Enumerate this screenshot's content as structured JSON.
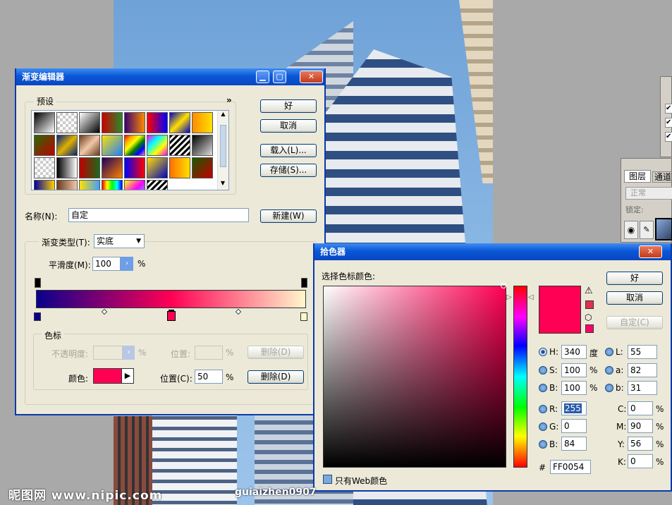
{
  "gradient_editor": {
    "title": "渐变编辑器",
    "presets_label": "预设",
    "presets_menu": "»",
    "ok": "好",
    "cancel": "取消",
    "load": "载入(L)...",
    "save": "存储(S)...",
    "name_label": "名称(N):",
    "name_value": "自定",
    "new_button": "新建(W)",
    "gradient_type_label": "渐变类型(T):",
    "gradient_type_value": "实底",
    "smoothness_label": "平滑度(M):",
    "smoothness_value": "100",
    "smoothness_unit": "%",
    "stops_group": "色标",
    "opacity_label": "不透明度:",
    "opacity_unit": "%",
    "opacity_location_label": "位置:",
    "opacity_location_unit": "%",
    "opacity_delete": "删除(D)",
    "color_label": "颜色:",
    "color_location_label": "位置(C):",
    "color_location_value": "50",
    "color_location_unit": "%",
    "color_delete": "删除(D)",
    "gradient_colors": [
      "#0a008c",
      "#ff0054",
      "#fff7cc"
    ],
    "stop_color": "#ff0054"
  },
  "color_picker": {
    "title": "拾色器",
    "subtitle": "选择色标颜色:",
    "ok": "好",
    "cancel": "取消",
    "custom": "自定(C)",
    "h_label": "H:",
    "h_value": "340",
    "h_unit": "度",
    "s_label": "S:",
    "s_value": "100",
    "s_unit": "%",
    "b_label": "B:",
    "b_value": "100",
    "b_unit": "%",
    "r_label": "R:",
    "r_value": "255",
    "g_label": "G:",
    "g_value": "0",
    "b2_label": "B:",
    "b2_value": "84",
    "l_label": "L:",
    "l_value": "55",
    "a_label": "a:",
    "a_value": "82",
    "lab_b_label": "b:",
    "lab_b_value": "31",
    "c_label": "C:",
    "c_value": "0",
    "c_unit": "%",
    "m_label": "M:",
    "m_value": "90",
    "m_unit": "%",
    "y_label": "Y:",
    "y_value": "56",
    "y_unit": "%",
    "k_label": "K:",
    "k_value": "0",
    "k_unit": "%",
    "hex_label": "#",
    "hex_value": "FF0054",
    "web_only": "只有Web颜色",
    "current_color": "#ff0054"
  },
  "layers_panel": {
    "tab_layers": "图层",
    "tab_channels": "通道",
    "blend_mode": "正常",
    "lock_label": "锁定:"
  },
  "watermark": {
    "brand": "昵图网 www.nipic.com",
    "author": "guiaizhen0907"
  }
}
